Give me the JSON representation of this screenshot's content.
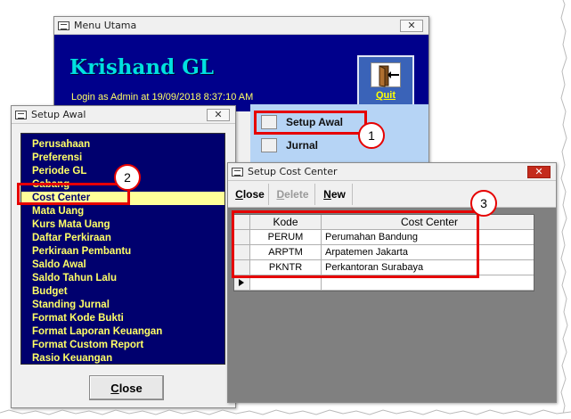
{
  "menu_utama": {
    "title": "Menu Utama",
    "app_title": "Krishand GL",
    "login_status": "Login as Admin at 19/09/2018 8:37:10 AM",
    "quit_label": "Quit",
    "menu_items": [
      {
        "label": "Setup Awal"
      },
      {
        "label": "Jurnal"
      }
    ]
  },
  "setup_awal": {
    "title": "Setup Awal",
    "items": [
      "Perusahaan",
      "Preferensi",
      "Periode GL",
      "Cabang",
      "Cost Center",
      "Mata Uang",
      "Kurs Mata Uang",
      "Daftar Perkiraan",
      "Perkiraan Pembantu",
      "Saldo Awal",
      "Saldo Tahun Lalu",
      "Budget",
      "Standing Jurnal",
      "Format Kode Bukti",
      "Format Laporan Keuangan",
      "Format Custom Report",
      "Rasio Keuangan"
    ],
    "selected_item": "Cost Center",
    "close_label": "Close"
  },
  "setup_cost_center": {
    "title": "Setup Cost Center",
    "toolbar": {
      "close": "Close",
      "delete": "Delete",
      "new": "New"
    },
    "columns": [
      "Kode",
      "Cost Center"
    ],
    "rows": [
      {
        "kode": "PERUM",
        "cost_center": "Perumahan Bandung"
      },
      {
        "kode": "ARPTM",
        "cost_center": "Arpatemen Jakarta"
      },
      {
        "kode": "PKNTR",
        "cost_center": "Perkantoran Surabaya"
      }
    ]
  },
  "callouts": [
    "1",
    "2",
    "3"
  ],
  "colors": {
    "header_navy": "#00008b",
    "title_cyan": "#00e0e0",
    "list_yellow": "#ffff66",
    "highlight_red": "#e60000",
    "panel_blue": "#b6d4f5"
  }
}
